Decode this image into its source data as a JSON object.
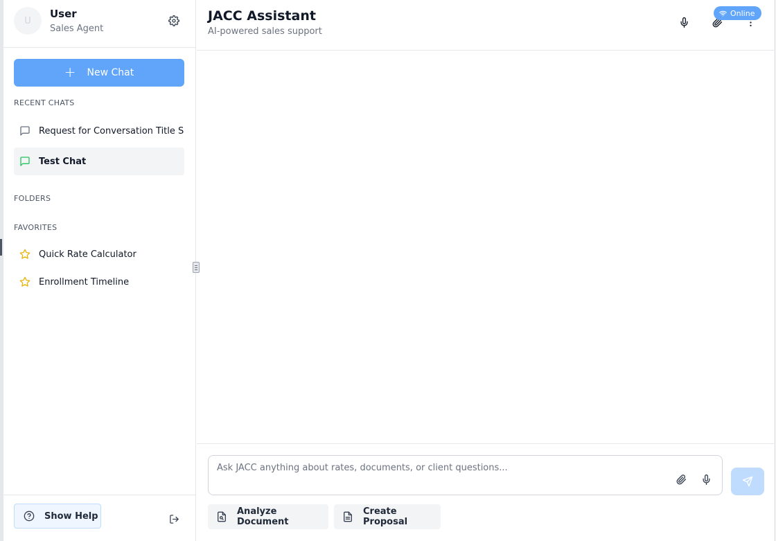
{
  "profile": {
    "avatar_initial": "U",
    "name": "User",
    "role": "Sales Agent"
  },
  "sidebar": {
    "new_chat_label": "New Chat",
    "recent_title": "RECENT CHATS",
    "recent_chats": [
      {
        "label": "Request for Conversation Title Suggestion",
        "icon": "message-square-icon",
        "active": false
      },
      {
        "label": "Test Chat",
        "icon": "message-square-icon",
        "active": true
      }
    ],
    "folders_title": "FOLDERS",
    "favorites_title": "FAVORITES",
    "favorites": [
      {
        "label": "Quick Rate Calculator",
        "icon": "star-icon"
      },
      {
        "label": "Enrollment Timeline",
        "icon": "star-icon"
      }
    ],
    "help_label": "Show Help"
  },
  "header": {
    "title": "JACC Assistant",
    "subtitle": "AI-powered sales support",
    "status": "Online"
  },
  "composer": {
    "placeholder": "Ask JACC anything about rates, documents, or client questions...",
    "actions": [
      {
        "label": "Analyze Document",
        "icon": "file-search-icon"
      },
      {
        "label": "Create Proposal",
        "icon": "file-text-icon"
      }
    ]
  },
  "colors": {
    "accent": "#60a5fa",
    "send_disabled": "#bfdbfe",
    "star": "#eab308",
    "active_chat_icon": "#22c55e"
  }
}
